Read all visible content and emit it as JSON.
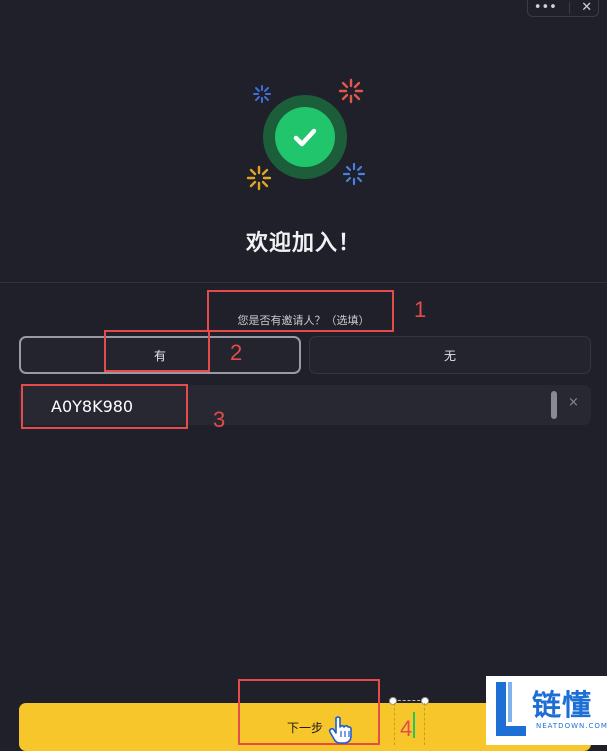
{
  "window_controls": {
    "more": "•••",
    "close": "✕"
  },
  "hero": {
    "welcome_text": "欢迎加入！"
  },
  "invite": {
    "question": "您是否有邀请人？（选填）",
    "option_yes": "有",
    "option_no": "无",
    "code_value": "A0Y8K980",
    "clear": "×",
    "selected_option": "有"
  },
  "actions": {
    "next_label": "下一步"
  },
  "annotations": {
    "n1": "1",
    "n2": "2",
    "n3": "3",
    "n4": "4"
  },
  "watermark": {
    "cn": "链懂",
    "en": "NEATDOWN.COM"
  },
  "colors": {
    "background": "#1f2029",
    "accent_yellow": "#f7c62a",
    "success_green": "#21c56b",
    "annotation_red": "#e44b4b",
    "watermark_blue": "#1d6fd6"
  },
  "icons": {
    "success": "check-circle-icon",
    "sparkles": "sparkle-icon",
    "pointer": "hand-pointer-icon"
  }
}
